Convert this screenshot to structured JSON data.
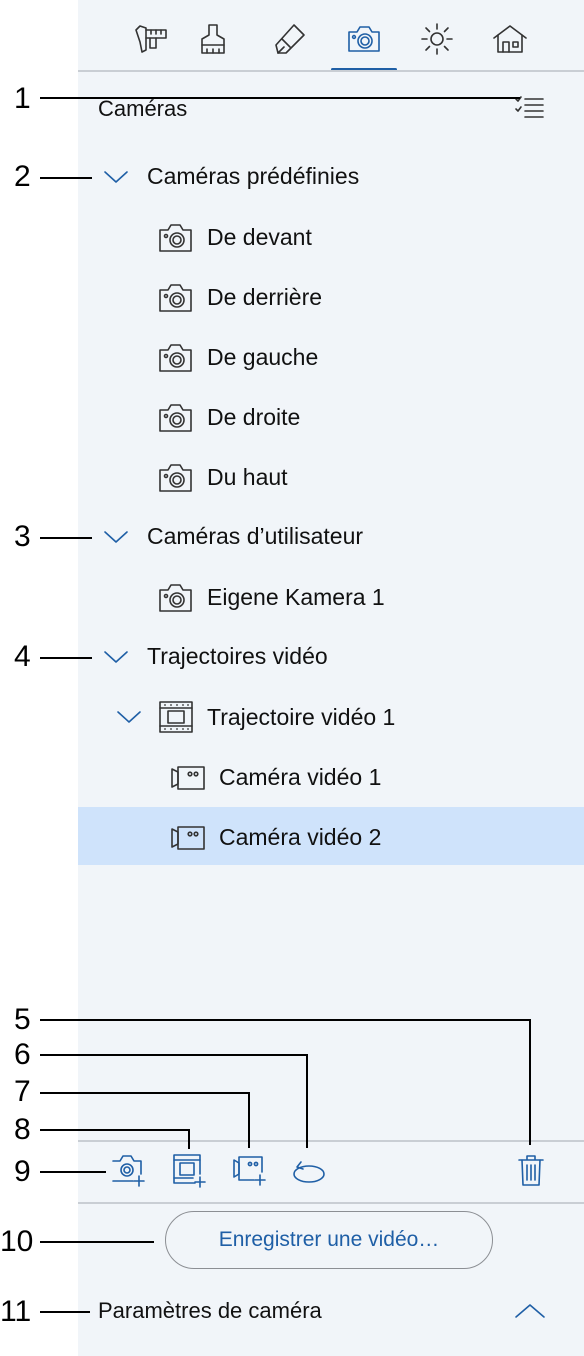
{
  "tabs": [
    {
      "name": "measure-tab",
      "icon": "measure-icon"
    },
    {
      "name": "stamp-tab",
      "icon": "stamp-icon"
    },
    {
      "name": "eraser-tab",
      "icon": "eraser-icon"
    },
    {
      "name": "camera-tab",
      "icon": "camera-icon",
      "active": true
    },
    {
      "name": "light-tab",
      "icon": "sun-icon"
    },
    {
      "name": "house-tab",
      "icon": "house-icon"
    }
  ],
  "header": {
    "title": "Caméras",
    "select_icon": "checklist-icon"
  },
  "tree": {
    "predefined": {
      "label": "Caméras prédéfinies",
      "items": [
        "De devant",
        "De derrière",
        "De gauche",
        "De droite",
        "Du haut"
      ]
    },
    "user": {
      "label": "Caméras d’utilisateur",
      "items": [
        "Eigene Kamera 1"
      ]
    },
    "video": {
      "label": "Trajectoires vidéo",
      "path": {
        "label": "Trajectoire vidéo 1",
        "items": [
          "Caméra vidéo 1",
          "Caméra vidéo 2"
        ],
        "selected_index": 1
      }
    }
  },
  "toolbar": {
    "icons": [
      "add-camera-icon",
      "add-video-path-icon",
      "add-video-camera-icon",
      "rotate-icon",
      "trash-icon"
    ]
  },
  "record_button": "Enregistrer une vidéo…",
  "settings": {
    "label": "Paramètres de caméra",
    "icon": "chevron-up-icon"
  },
  "callouts": [
    "1",
    "2",
    "3",
    "4",
    "5",
    "6",
    "7",
    "8",
    "9",
    "10",
    "11"
  ],
  "colors": {
    "accent": "#1f5fa6",
    "panel_bg": "#f1f5f9",
    "selected_bg": "#cfe3fb"
  }
}
